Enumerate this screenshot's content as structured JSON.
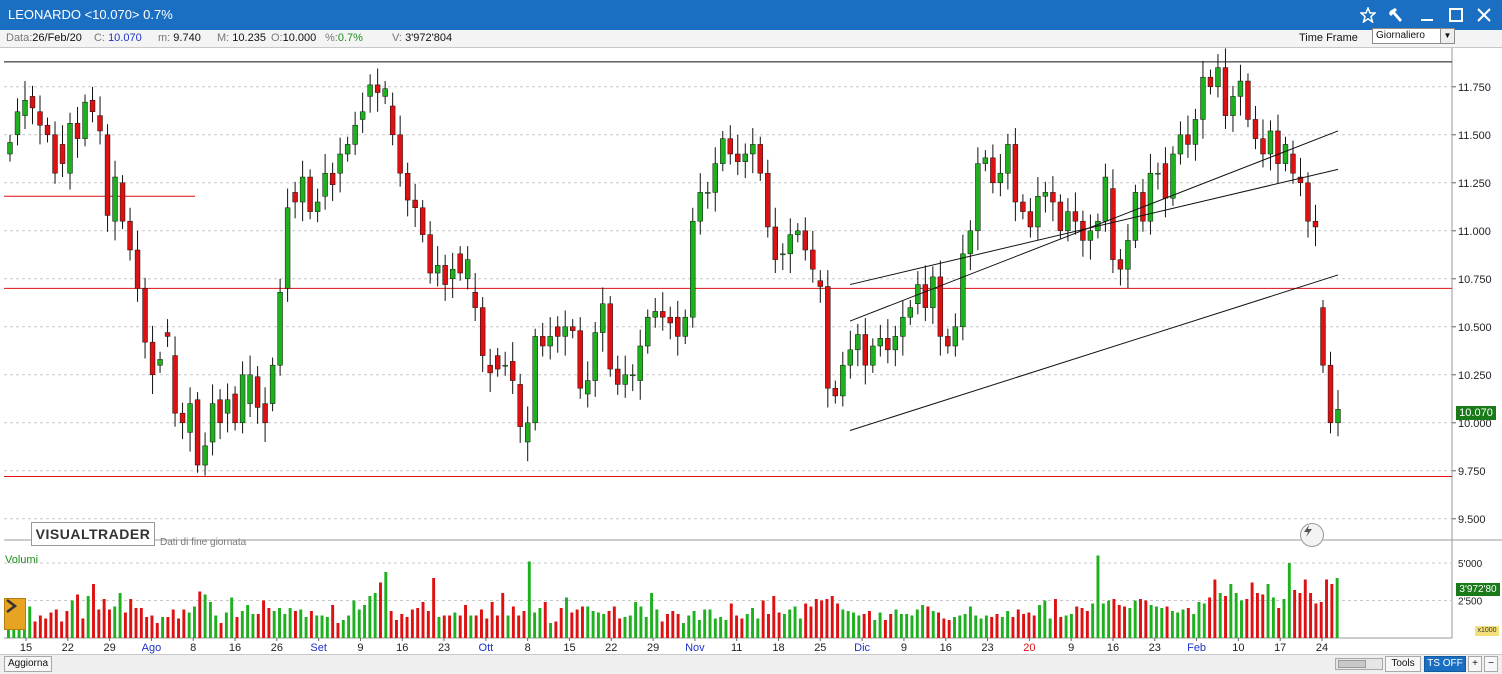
{
  "window": {
    "title": "LEONARDO <10.070>  0.7%",
    "icons": [
      "star-icon",
      "hammer-icon",
      "minimize-icon",
      "maximize-icon",
      "close-icon"
    ]
  },
  "info_bar": {
    "data_label": "Data:",
    "data_value": "26/Feb/20",
    "close_label": "C:",
    "close_value": "10.070",
    "min_label": "m:",
    "min_value": "9.740",
    "max_label": "M:",
    "max_value": "10.235",
    "open_label": "O:",
    "open_value": "10.000",
    "pct_label": "%:",
    "pct_value": "0.7%",
    "volume_label": "V:",
    "volume_value": "3'972'804",
    "timeframe_label": "Time Frame",
    "timeframe_value": "Giornaliero"
  },
  "chart": {
    "watermark": "VISUALTRADER",
    "watermark_sub": "Dati di fine giornata",
    "volume_label": "Volumi",
    "last_price_tag": "10.070",
    "volume_tag": "3'972'80",
    "volume_unit": "x1000",
    "colors": {
      "up": "#1fb01f",
      "down": "#dd1111",
      "hline": "#dd1111",
      "grid": "#c8c8c8"
    }
  },
  "chart_data": {
    "type": "candlestick",
    "ylim": [
      9.4,
      11.9
    ],
    "y_ticks": [
      "11.750",
      "11.500",
      "11.250",
      "11.000",
      "10.750",
      "10.500",
      "10.250",
      "10.000",
      "9.750",
      "9.500"
    ],
    "volume_ticks": [
      "5'000",
      "2'500"
    ],
    "x_ticks": [
      {
        "label": "15",
        "blue": false
      },
      {
        "label": "22",
        "blue": false
      },
      {
        "label": "29",
        "blue": false
      },
      {
        "label": "Ago",
        "blue": true
      },
      {
        "label": "8",
        "blue": false
      },
      {
        "label": "16",
        "blue": false
      },
      {
        "label": "26",
        "blue": false
      },
      {
        "label": "Set",
        "blue": true
      },
      {
        "label": "9",
        "blue": false
      },
      {
        "label": "16",
        "blue": false
      },
      {
        "label": "23",
        "blue": false
      },
      {
        "label": "Ott",
        "blue": true
      },
      {
        "label": "8",
        "blue": false
      },
      {
        "label": "15",
        "blue": false
      },
      {
        "label": "22",
        "blue": false
      },
      {
        "label": "29",
        "blue": false
      },
      {
        "label": "Nov",
        "blue": true
      },
      {
        "label": "11",
        "blue": false
      },
      {
        "label": "18",
        "blue": false
      },
      {
        "label": "25",
        "blue": false
      },
      {
        "label": "Dic",
        "blue": true
      },
      {
        "label": "9",
        "blue": false
      },
      {
        "label": "16",
        "blue": false
      },
      {
        "label": "23",
        "blue": false
      },
      {
        "label": "20",
        "blue": false,
        "red": true
      },
      {
        "label": "9",
        "blue": false
      },
      {
        "label": "16",
        "blue": false
      },
      {
        "label": "23",
        "blue": false
      },
      {
        "label": "Feb",
        "blue": true
      },
      {
        "label": "10",
        "blue": false
      },
      {
        "label": "17",
        "blue": false
      },
      {
        "label": "24",
        "blue": false
      }
    ],
    "close": [
      11.46,
      11.62,
      11.68,
      11.64,
      11.55,
      11.5,
      11.3,
      11.35,
      11.56,
      11.48,
      11.67,
      11.62,
      11.52,
      11.08,
      11.28,
      11.05,
      10.9,
      10.7,
      10.42,
      10.25,
      10.33,
      10.45,
      10.05,
      10.0,
      10.1,
      9.78,
      9.88,
      10.1,
      10.0,
      10.12,
      10.0,
      10.25,
      10.25,
      10.08,
      10.0,
      10.3,
      10.68,
      11.12,
      11.15,
      11.28,
      11.1,
      11.15,
      11.3,
      11.24,
      11.4,
      11.45,
      11.55,
      11.62,
      11.76,
      11.72,
      11.74,
      11.5,
      11.3,
      11.16,
      11.12,
      10.98,
      10.78,
      10.82,
      10.72,
      10.8,
      10.78,
      10.85,
      10.6,
      10.35,
      10.26,
      10.28,
      10.3,
      10.22,
      9.98,
      10.0,
      10.45,
      10.4,
      10.45,
      10.45,
      10.5,
      10.48,
      10.18,
      10.22,
      10.47,
      10.62,
      10.28,
      10.2,
      10.25,
      10.25,
      10.4,
      10.55,
      10.58,
      10.55,
      10.52,
      10.45,
      10.55,
      11.05,
      11.2,
      11.2,
      11.35,
      11.48,
      11.4,
      11.36,
      11.4,
      11.45,
      11.3,
      11.02,
      10.85,
      10.88,
      10.98,
      11.0,
      10.9,
      10.8,
      10.71,
      10.18,
      10.14,
      10.3,
      10.38,
      10.46,
      10.3,
      10.4,
      10.44,
      10.38,
      10.45,
      10.55,
      10.6,
      10.72,
      10.6,
      10.76,
      10.45,
      10.4,
      10.5,
      10.88,
      11.0,
      11.35,
      11.38,
      11.25,
      11.3,
      11.45,
      11.15,
      11.1,
      11.02,
      11.18,
      11.2,
      11.15,
      11.0,
      11.1,
      11.05,
      10.95,
      11.0,
      11.05,
      11.28,
      10.85,
      10.8,
      10.95,
      11.2,
      11.05,
      11.3,
      11.3,
      11.17,
      11.4,
      11.5,
      11.45,
      11.58,
      11.8,
      11.75,
      11.85,
      11.6,
      11.7,
      11.78,
      11.58,
      11.48,
      11.4,
      11.52,
      11.35,
      11.45,
      11.3,
      11.25,
      11.05,
      11.02,
      10.3,
      10.0,
      10.07
    ],
    "open": [
      11.4,
      11.5,
      11.6,
      11.7,
      11.62,
      11.55,
      11.5,
      11.45,
      11.3,
      11.56,
      11.48,
      11.68,
      11.6,
      11.5,
      11.05,
      11.25,
      11.05,
      10.9,
      10.7,
      10.42,
      10.3,
      10.47,
      10.35,
      10.05,
      9.95,
      10.12,
      9.78,
      9.9,
      10.12,
      10.05,
      10.15,
      10.0,
      10.1,
      10.24,
      10.1,
      10.1,
      10.3,
      10.7,
      11.2,
      11.15,
      11.28,
      11.1,
      11.18,
      11.3,
      11.3,
      11.4,
      11.45,
      11.58,
      11.7,
      11.76,
      11.7,
      11.65,
      11.5,
      11.3,
      11.16,
      11.12,
      10.98,
      10.78,
      10.82,
      10.75,
      10.88,
      10.75,
      10.68,
      10.6,
      10.3,
      10.35,
      10.3,
      10.32,
      10.2,
      9.9,
      10.0,
      10.45,
      10.4,
      10.5,
      10.45,
      10.5,
      10.48,
      10.15,
      10.22,
      10.47,
      10.62,
      10.28,
      10.2,
      10.25,
      10.22,
      10.4,
      10.55,
      10.58,
      10.55,
      10.55,
      10.45,
      10.55,
      11.05,
      11.2,
      11.2,
      11.35,
      11.48,
      11.4,
      11.36,
      11.4,
      11.45,
      11.3,
      11.02,
      10.88,
      10.88,
      10.98,
      11.0,
      10.9,
      10.74,
      10.71,
      10.18,
      10.14,
      10.3,
      10.38,
      10.46,
      10.3,
      10.4,
      10.44,
      10.38,
      10.45,
      10.55,
      10.62,
      10.72,
      10.6,
      10.76,
      10.45,
      10.4,
      10.5,
      10.88,
      11.0,
      11.35,
      11.38,
      11.25,
      11.3,
      11.45,
      11.15,
      11.1,
      11.02,
      11.18,
      11.2,
      11.15,
      11.0,
      11.1,
      11.05,
      10.95,
      11.0,
      11.05,
      11.22,
      10.85,
      10.8,
      10.95,
      11.2,
      11.05,
      11.3,
      11.35,
      11.17,
      11.4,
      11.5,
      11.45,
      11.58,
      11.8,
      11.75,
      11.85,
      11.6,
      11.7,
      11.78,
      11.58,
      11.48,
      11.4,
      11.52,
      11.35,
      11.4,
      11.28,
      11.25,
      11.05,
      10.6,
      10.3,
      10.0
    ],
    "volume_k": [
      2000,
      1300,
      700,
      1200,
      2100,
      1100,
      1500,
      1300,
      1700,
      1900,
      1100,
      1800,
      2500,
      2900,
      1300,
      2800,
      3600,
      1900,
      2600,
      1900,
      2100,
      3000,
      1700,
      2600,
      2000,
      2000,
      1400,
      1500,
      1000,
      1400,
      1400,
      1900,
      1300,
      1900,
      1700,
      2100,
      3100,
      2900,
      2400,
      1500,
      1000,
      1700,
      2700,
      1400,
      1800,
      2200,
      1600,
      1600,
      2500,
      2000,
      1800,
      2000,
      1600,
      2000,
      1800,
      1900,
      1400,
      1800,
      1500,
      1500,
      1400,
      2200,
      1000,
      1200,
      1500,
      2500,
      1900,
      2200,
      2800,
      3000,
      3700,
      4400,
      1800,
      1200,
      1600,
      1400,
      1900,
      2000,
      2400,
      1800,
      4000,
      1400,
      1500,
      1500,
      1700,
      1500,
      2200,
      1500,
      1500,
      1900,
      1300,
      2400,
      1500,
      3000,
      1500,
      2100,
      1500,
      1800,
      5100,
      1700,
      2000,
      2400,
      1000,
      1100,
      2000,
      2700,
      1700,
      1900,
      2100,
      2100,
      1800,
      1700,
      1600,
      1800,
      2100,
      1300,
      1400,
      1500,
      2400,
      2100,
      1400,
      3000,
      1900,
      1100,
      1600,
      1800,
      1600,
      1000,
      1500,
      1800,
      1200,
      1900,
      1900,
      1300,
      1400,
      1200,
      2300,
      1500,
      1300,
      1600,
      2000,
      1300,
      2500,
      1600,
      2800,
      1700,
      1600,
      1900,
      2100,
      1300,
      2300,
      2100,
      2600,
      2500,
      2600,
      2800,
      2300,
      1900,
      1800,
      1700,
      1500,
      1600,
      1800,
      1200,
      1700,
      1200,
      1600,
      1900,
      1600,
      1600,
      1500,
      1900,
      2200,
      2100,
      1800,
      1700,
      1300,
      1200,
      1400,
      1500,
      1600,
      2100,
      1500,
      1300,
      1500,
      1400,
      1600,
      1400,
      1800,
      1400,
      1900,
      1600,
      1700,
      1500,
      2200,
      2500,
      1300,
      2600,
      1400,
      1500,
      1600,
      2100,
      2000,
      1800,
      2300,
      5500,
      2300,
      2500,
      2600,
      2200,
      2100,
      2000,
      2500,
      2600,
      2500,
      2200,
      2100,
      2000,
      2100,
      1800,
      1700,
      1900,
      2000,
      1600,
      2400,
      2300,
      2700,
      3900,
      3000,
      2800,
      3600,
      3000,
      2500,
      2600,
      3700,
      3000,
      2900,
      3600,
      2700,
      2000,
      2600,
      5000,
      3200,
      3000,
      3900,
      3000,
      2300,
      2400,
      3900,
      3600,
      4000
    ]
  }
}
